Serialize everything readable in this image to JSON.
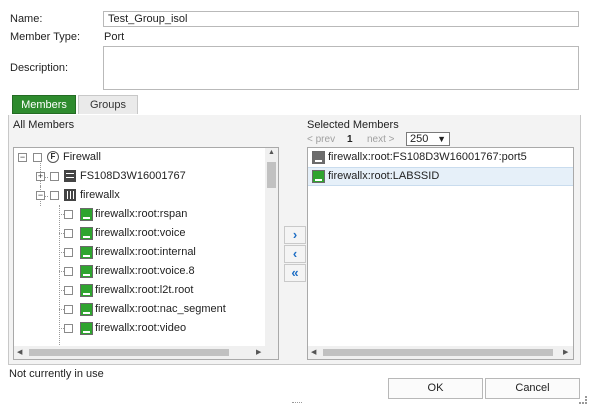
{
  "form": {
    "name_label": "Name:",
    "name_value": "Test_Group_isol",
    "member_type_label": "Member Type:",
    "member_type_value": "Port",
    "description_label": "Description:",
    "description_value": ""
  },
  "tabs": [
    {
      "label": "Members",
      "active": true
    },
    {
      "label": "Groups",
      "active": false
    }
  ],
  "all_members": {
    "title": "All Members",
    "tree": [
      {
        "label": "Firewall",
        "level": 0,
        "expander": "−",
        "icon": "firewall-folder-icon"
      },
      {
        "label": "FS108D3W16001767",
        "level": 1,
        "expander": "+",
        "icon": "switch-icon"
      },
      {
        "label": "firewallx",
        "level": 1,
        "expander": "−",
        "icon": "fortigate-icon"
      },
      {
        "label": "firewallx:root:rspan",
        "level": 2,
        "icon": "port-icon"
      },
      {
        "label": "firewallx:root:voice",
        "level": 2,
        "icon": "port-icon"
      },
      {
        "label": "firewallx:root:internal",
        "level": 2,
        "icon": "port-icon"
      },
      {
        "label": "firewallx:root:voice.8",
        "level": 2,
        "icon": "port-icon"
      },
      {
        "label": "firewallx:root:l2t.root",
        "level": 2,
        "icon": "port-icon"
      },
      {
        "label": "firewallx:root:nac_segment",
        "level": 2,
        "icon": "port-icon"
      },
      {
        "label": "firewallx:root:video",
        "level": 2,
        "icon": "port-icon"
      }
    ]
  },
  "selected_members": {
    "title": "Selected Members",
    "pager": {
      "prev": "< prev",
      "page": "1",
      "next": "next >",
      "page_size": "250"
    },
    "items": [
      {
        "label": "firewallx:root:FS108D3W16001767:port5",
        "icon": "gray",
        "highlighted": false
      },
      {
        "label": "firewallx:root:LABSSID",
        "icon": "green",
        "highlighted": true
      }
    ]
  },
  "transfer": {
    "add": "›",
    "remove": "‹",
    "remove_all": "«"
  },
  "status_text": "Not currently in use",
  "buttons": {
    "ok": "OK",
    "cancel": "Cancel"
  }
}
